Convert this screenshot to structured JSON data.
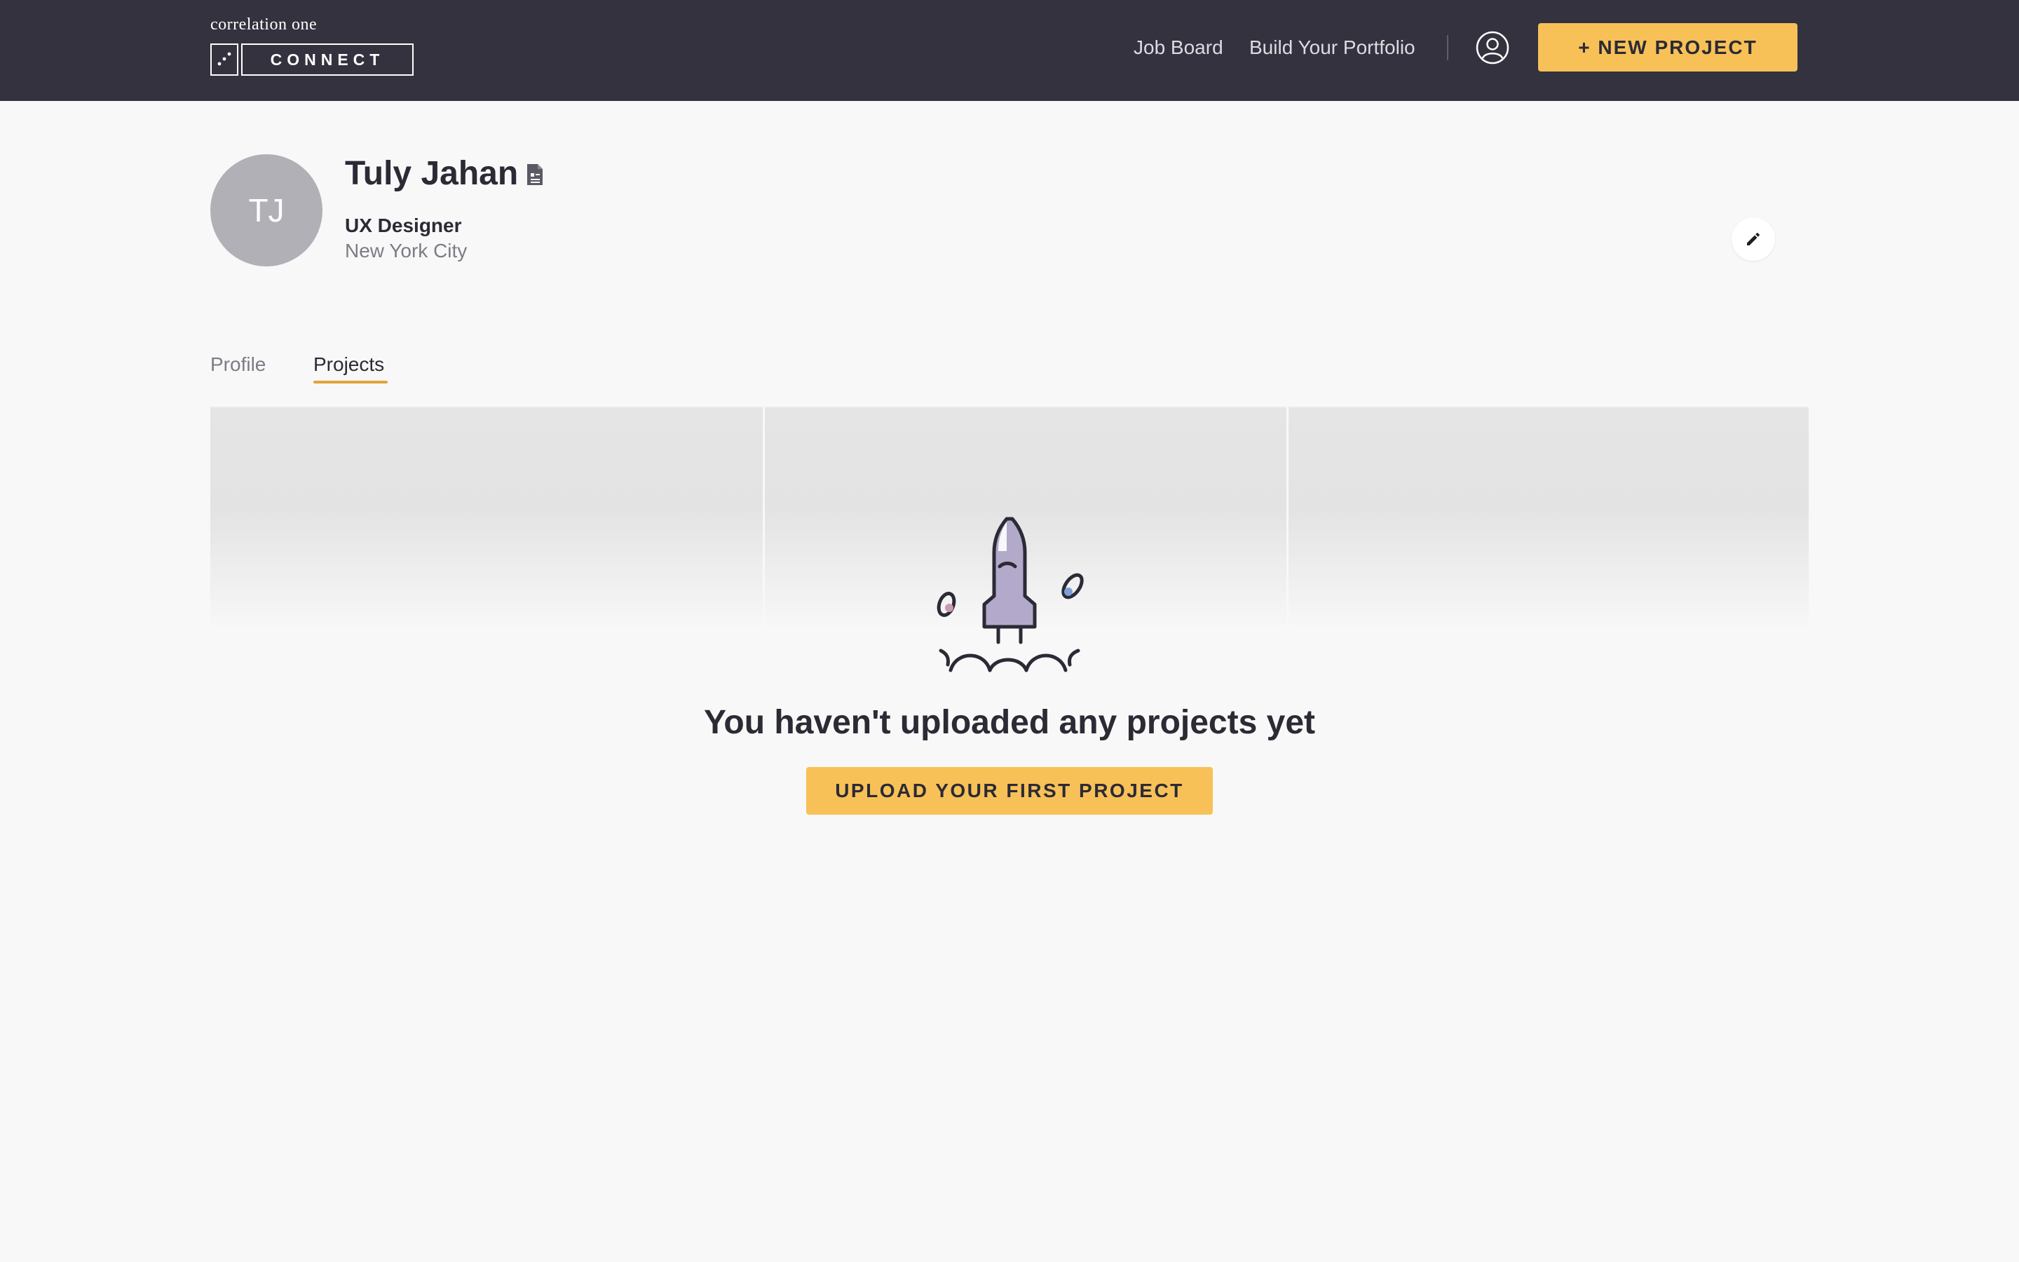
{
  "brand": {
    "wordmark": "correlation one",
    "product": "CONNECT"
  },
  "nav": {
    "job_board": "Job Board",
    "build_portfolio": "Build Your Portfolio",
    "new_project": "+ NEW PROJECT"
  },
  "profile": {
    "initials": "TJ",
    "name": "Tuly Jahan",
    "title": "UX Designer",
    "location": "New York City"
  },
  "tabs": [
    {
      "label": "Profile",
      "active": false
    },
    {
      "label": "Projects",
      "active": true
    }
  ],
  "empty_state": {
    "message": "You haven't uploaded any projects yet",
    "cta": "UPLOAD YOUR FIRST PROJECT"
  },
  "icons": {
    "user": "user-circle-icon",
    "resume": "document-icon",
    "edit": "pencil-icon",
    "illustration": "rocket-illustration"
  },
  "colors": {
    "header_bg": "#33323e",
    "accent": "#f7c158",
    "tab_underline": "#e2a33a",
    "avatar_bg": "#b1b0b7",
    "rocket_fill": "#b2a9cb"
  }
}
